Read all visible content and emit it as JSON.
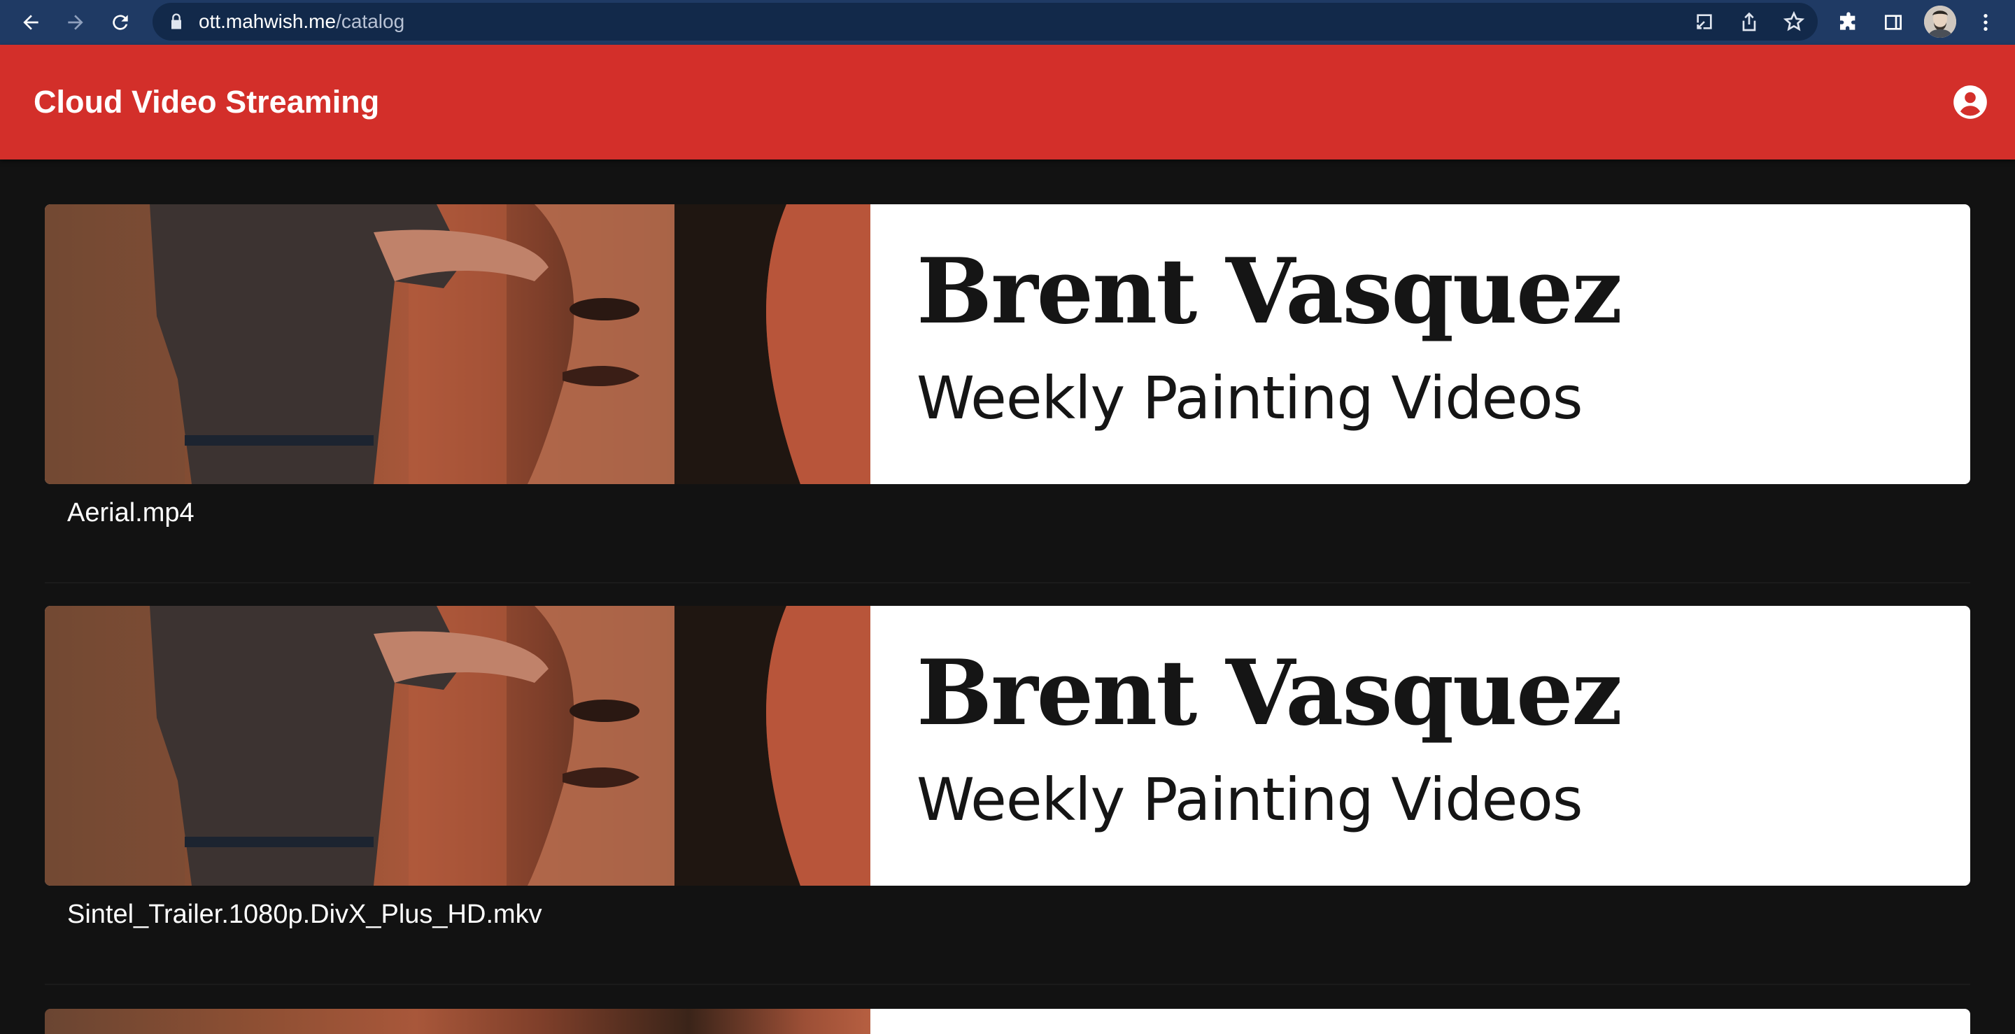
{
  "browser": {
    "url_host": "ott.mahwish.me",
    "url_path": "/catalog"
  },
  "app": {
    "title": "Cloud Video Streaming"
  },
  "banner": {
    "name": "Brent Vasquez",
    "tagline": "Weekly Painting Videos"
  },
  "videos": [
    {
      "title": "Aerial.mp4"
    },
    {
      "title": "Sintel_Trailer.1080p.DivX_Plus_HD.mkv"
    }
  ],
  "colors": {
    "appbar": "#d32f2a",
    "background": "#121212",
    "chrome": "#1f3a64"
  },
  "icons": {
    "back": "arrow-left-icon",
    "forward": "arrow-right-icon",
    "reload": "reload-icon",
    "lock": "lock-icon",
    "install": "install-icon",
    "share": "share-icon",
    "bookmark": "star-icon",
    "extensions": "puzzle-icon",
    "side_panel": "side-panel-icon",
    "menu": "kebab-menu-icon",
    "account": "account-circle-icon"
  }
}
